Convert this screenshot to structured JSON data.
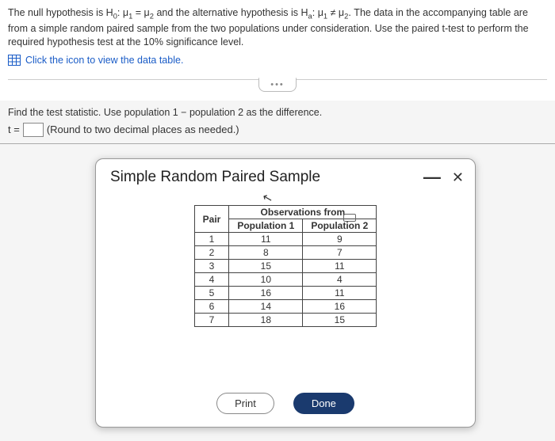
{
  "problem": {
    "line1_prefix": "The null hypothesis is H",
    "h0_sub": "0",
    "line1_mid1": ": μ",
    "mu1_sub": "1",
    "eq": " = μ",
    "mu2_sub": "2",
    "line1_mid2": " and the alternative hypothesis is H",
    "ha_sub": "a",
    "line1_mid3": ": μ",
    "ne": " ≠ μ",
    "line1_suffix": ". The data in the accompanying table are from a simple random paired sample from the two populations under consideration. Use the paired t-test to perform the required hypothesis test at the 10% significance level.",
    "click_text": "Click the icon to view the data table."
  },
  "question": {
    "prompt": "Find the test statistic. Use population 1 − population 2 as the difference.",
    "prefix": "t =",
    "hint": "(Round to two decimal places as needed.)"
  },
  "modal": {
    "title": "Simple Random Paired Sample",
    "obs_header": "Observations from",
    "col_pair": "Pair",
    "col_pop1": "Population 1",
    "col_pop2": "Population 2",
    "rows": [
      {
        "pair": "1",
        "p1": "11",
        "p2": "9"
      },
      {
        "pair": "2",
        "p1": "8",
        "p2": "7"
      },
      {
        "pair": "3",
        "p1": "15",
        "p2": "11"
      },
      {
        "pair": "4",
        "p1": "10",
        "p2": "4"
      },
      {
        "pair": "5",
        "p1": "16",
        "p2": "11"
      },
      {
        "pair": "6",
        "p1": "14",
        "p2": "16"
      },
      {
        "pair": "7",
        "p1": "18",
        "p2": "15"
      }
    ],
    "print": "Print",
    "done": "Done"
  }
}
